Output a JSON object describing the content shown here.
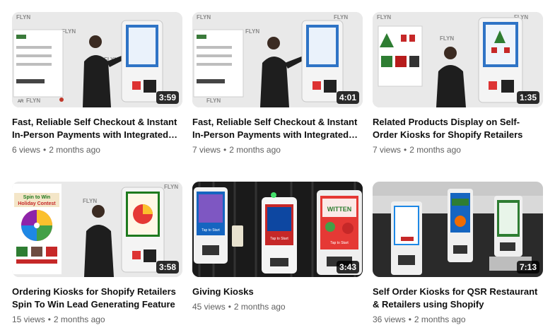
{
  "videos": [
    {
      "title": "Fast, Reliable Self Checkout & Instant In-Person Payments with Integrated…",
      "views": "6 views",
      "age": "2 months ago",
      "duration": "3:59",
      "thumb_label": "FLYN"
    },
    {
      "title": "Fast, Reliable Self Checkout & Instant In-Person Payments with Integrated…",
      "views": "7 views",
      "age": "2 months ago",
      "duration": "4:01",
      "thumb_label": "FLYN"
    },
    {
      "title": "Related Products Display on Self-Order Kiosks for Shopify Retailers",
      "views": "7 views",
      "age": "2 months ago",
      "duration": "1:35",
      "thumb_label": "FLYN"
    },
    {
      "title": "Ordering Kiosks for Shopify Retailers Spin To Win Lead Generating Feature",
      "views": "15 views",
      "age": "2 months ago",
      "duration": "3:58",
      "thumb_label": "FLYN",
      "overlay_title": "Spin to Win Holiday Contest"
    },
    {
      "title": "Giving Kiosks",
      "views": "45 views",
      "age": "2 months ago",
      "duration": "3:43",
      "kiosk_text": "Tap to Start"
    },
    {
      "title": "Self Order Kiosks for QSR Restaurant & Retailers using Shopify",
      "views": "36 views",
      "age": "2 months ago",
      "duration": "7:13"
    }
  ]
}
